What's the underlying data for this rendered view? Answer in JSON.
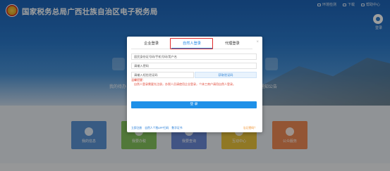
{
  "site": {
    "title": "国家税务总局广西壮族自治区电子税务局",
    "top_links": [
      "环境检测",
      "下载",
      "帮助中心"
    ],
    "user_label": "登录"
  },
  "background": {
    "left_side_label": "我的待办",
    "right_side_label": "通知公告",
    "tiles": [
      {
        "label": "我的信息",
        "color": "#5b93d3"
      },
      {
        "label": "我要办税",
        "color": "#84c25c"
      },
      {
        "label": "我要查询",
        "color": "#6a88d6"
      },
      {
        "label": "互动中心",
        "color": "#e9c23a"
      },
      {
        "label": "公众服务",
        "color": "#ee8a55"
      }
    ]
  },
  "login": {
    "tabs": [
      {
        "label": "企业登录",
        "active": false
      },
      {
        "label": "自然人登录",
        "active": true
      },
      {
        "label": "代理登录",
        "active": false
      }
    ],
    "close_label": "×",
    "account_placeholder": "居民身份证号码/手机号码/用户名",
    "password_placeholder": "请输入密码",
    "captcha_placeholder": "请输入短信验证码",
    "captcha_button": "获取验证码",
    "tip_title": "温馨提醒：",
    "tip_text": "自然人登录需要先注册，办税人员请使用企业登录，个体工商户请用自然人登录。",
    "login_button": "登 录",
    "bottom_links": [
      "立即注册",
      "自然人个税APP扫码",
      "数字证书"
    ],
    "forgot_link": "忘记密码？"
  },
  "colors": {
    "accent": "#1e90e8",
    "highlight": "#e02a2a",
    "tip": "#e04a3a"
  }
}
